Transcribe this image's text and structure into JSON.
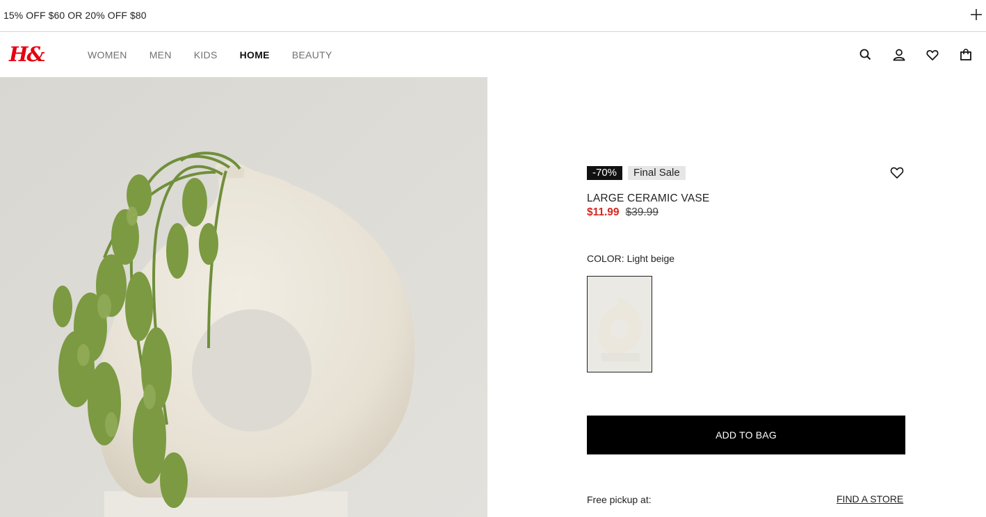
{
  "promo": {
    "text": "15% OFF $60 OR 20% OFF $80"
  },
  "brand": {
    "logo_text": "H&M",
    "logo_color": "#e50010"
  },
  "nav": {
    "items": [
      {
        "label": "WOMEN",
        "active": false
      },
      {
        "label": "MEN",
        "active": false
      },
      {
        "label": "KIDS",
        "active": false
      },
      {
        "label": "HOME",
        "active": true
      },
      {
        "label": "BEAUTY",
        "active": false
      }
    ]
  },
  "header_icons": [
    "search-icon",
    "account-icon",
    "heart-icon",
    "bag-icon"
  ],
  "product": {
    "discount_badge": "-70%",
    "final_sale_badge": "Final Sale",
    "name": "LARGE CERAMIC VASE",
    "sale_price": "$11.99",
    "original_price": "$39.99",
    "sale_color": "#d6271f",
    "color_label": "COLOR: Light beige",
    "add_to_bag": "ADD TO BAG",
    "pickup_label": "Free pickup at:",
    "find_store": "FIND A STORE"
  }
}
